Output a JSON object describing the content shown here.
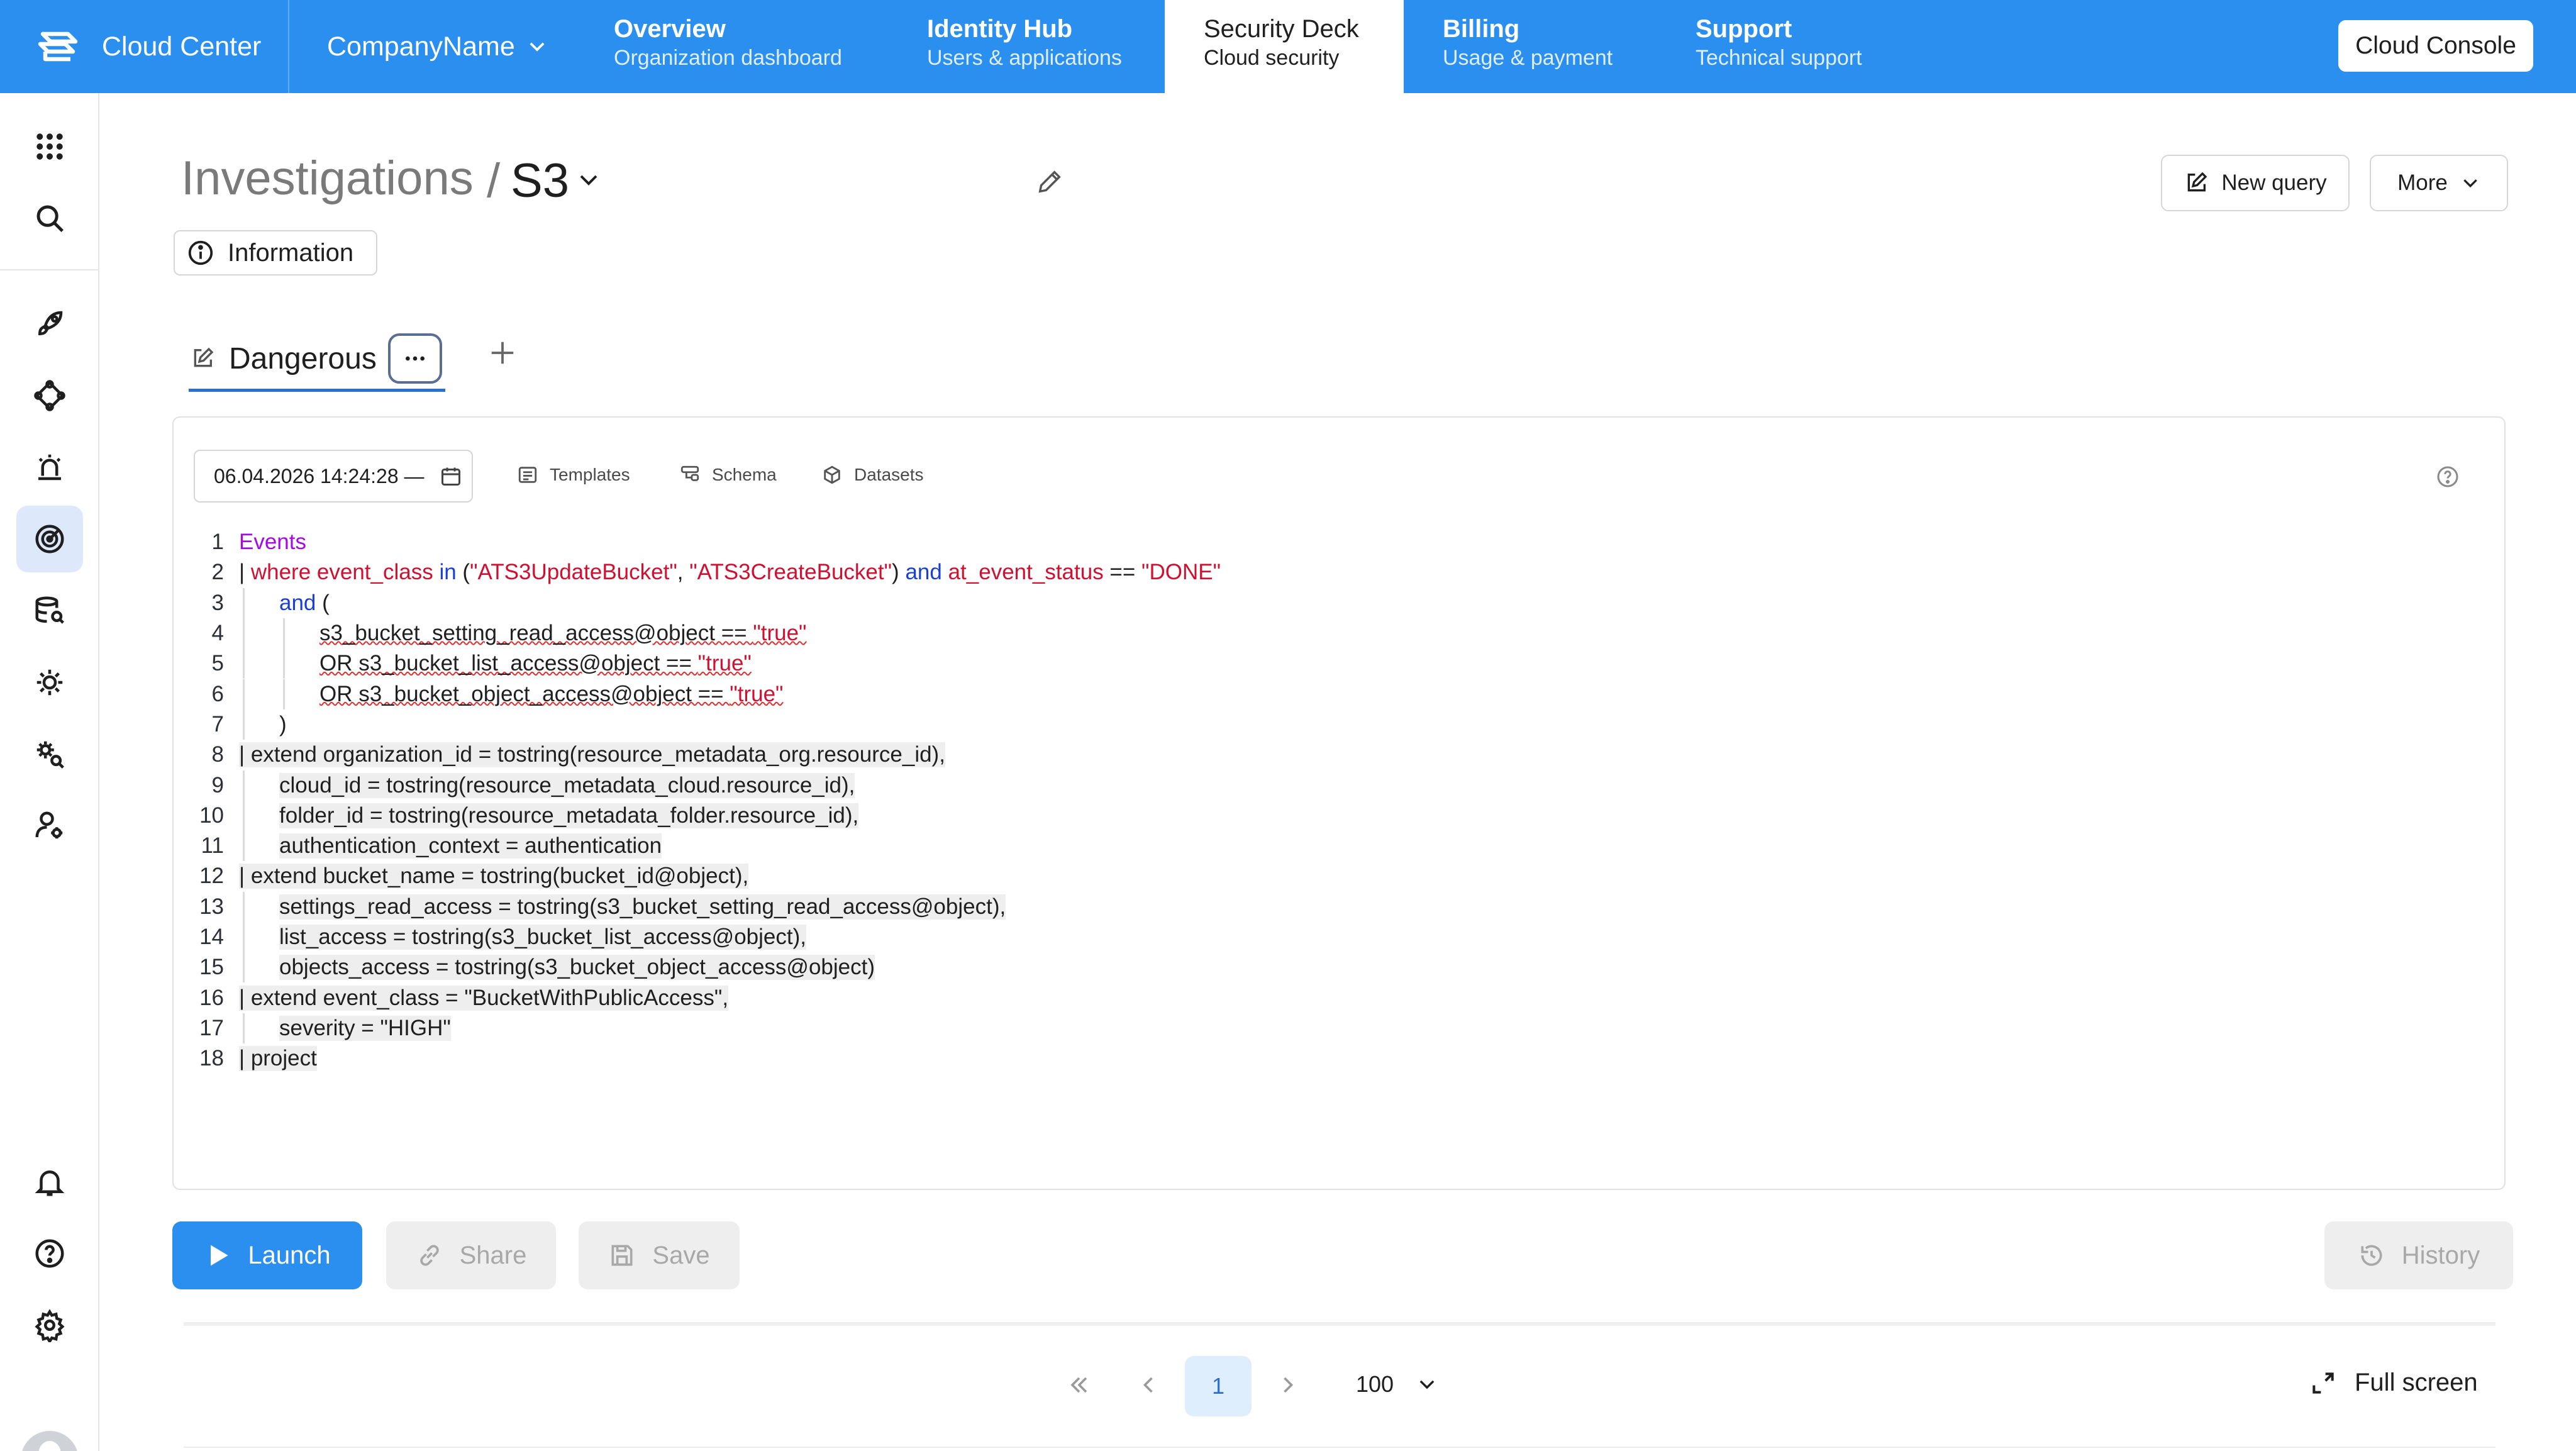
{
  "topbar": {
    "brand": "Cloud Center",
    "company": "CompanyName",
    "tabs": [
      {
        "title": "Overview",
        "subtitle": "Organization dashboard"
      },
      {
        "title": "Identity Hub",
        "subtitle": "Users & applications"
      },
      {
        "title": "Security Deck",
        "subtitle": "Cloud security"
      },
      {
        "title": "Billing",
        "subtitle": "Usage & payment"
      },
      {
        "title": "Support",
        "subtitle": "Technical support"
      }
    ],
    "active_tab": "Security Deck",
    "console_button": "Cloud Console"
  },
  "sidebar": {
    "icons": [
      "apps-grid-icon",
      "search-icon",
      "rocket-icon",
      "nodes-icon",
      "alarm-icon",
      "radar-icon",
      "database-search-icon",
      "settings-bug-icon",
      "gear-search-icon",
      "user-gear-icon",
      "bell-icon",
      "help-icon",
      "gear-icon"
    ],
    "active_icon": "radar-icon"
  },
  "header": {
    "breadcrumb_base": "Investigations",
    "separator": "/",
    "current": "S3",
    "new_query_button": "New query",
    "more_button": "More",
    "information_label": "Information"
  },
  "query_tab": {
    "label": "Dangerous"
  },
  "editor": {
    "datetime": "06.04.2026 14:24:28 —",
    "tools": [
      "Templates",
      "Schema",
      "Datasets"
    ],
    "lines": [
      {
        "n": "1",
        "text": "Events"
      },
      {
        "n": "2",
        "text": "| where event_class in (\"ATS3UpdateBucket\", \"ATS3CreateBucket\") and at_event_status == \"DONE\""
      },
      {
        "n": "3",
        "text": "and ("
      },
      {
        "n": "4",
        "text": "s3_bucket_setting_read_access@object == \"true\""
      },
      {
        "n": "5",
        "text": "OR s3_bucket_list_access@object == \"true\""
      },
      {
        "n": "6",
        "text": "OR s3_bucket_object_access@object == \"true\""
      },
      {
        "n": "7",
        "text": ")"
      },
      {
        "n": "8",
        "text": "| extend organization_id = tostring(resource_metadata_org.resource_id),"
      },
      {
        "n": "9",
        "text": "cloud_id = tostring(resource_metadata_cloud.resource_id),"
      },
      {
        "n": "10",
        "text": "folder_id = tostring(resource_metadata_folder.resource_id),"
      },
      {
        "n": "11",
        "text": "authentication_context = authentication"
      },
      {
        "n": "12",
        "text": "| extend bucket_name = tostring(bucket_id@object),"
      },
      {
        "n": "13",
        "text": "settings_read_access = tostring(s3_bucket_setting_read_access@object),"
      },
      {
        "n": "14",
        "text": "list_access = tostring(s3_bucket_list_access@object),"
      },
      {
        "n": "15",
        "text": "objects_access = tostring(s3_bucket_object_access@object)"
      },
      {
        "n": "16",
        "text": "| extend event_class = \"BucketWithPublicAccess\","
      },
      {
        "n": "17",
        "text": "severity = \"HIGH\""
      },
      {
        "n": "18",
        "text": "| project"
      }
    ]
  },
  "actions": {
    "launch": "Launch",
    "share": "Share",
    "save": "Save",
    "history": "History"
  },
  "pagination": {
    "current_page": "1",
    "page_size": "100",
    "fullscreen": "Full screen"
  },
  "colors": {
    "accent": "#2b8ff0",
    "keyword_purple": "#a40be0",
    "keyword_red": "#d01030",
    "keyword_blue": "#1a3fd6"
  }
}
